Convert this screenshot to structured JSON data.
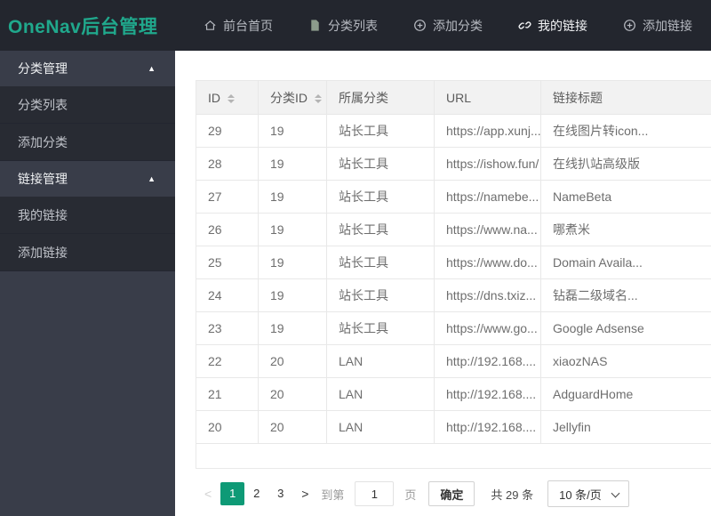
{
  "app": {
    "title": "OneNav后台管理"
  },
  "colors": {
    "accent": "#0e9a76",
    "logo": "#20a88c",
    "topbar_bg": "#23262E",
    "sidebar_bg": "#393D49",
    "sidebar_item_bg": "#282B33",
    "table_header_bg": "#f2f2f2"
  },
  "topnav": {
    "items": [
      {
        "label": "前台首页",
        "icon": "home-icon",
        "active": false
      },
      {
        "label": "分类列表",
        "icon": "document-icon",
        "active": false
      },
      {
        "label": "添加分类",
        "icon": "add-circle-icon",
        "active": false
      },
      {
        "label": "我的链接",
        "icon": "link-icon",
        "active": true
      },
      {
        "label": "添加链接",
        "icon": "add-circle-icon",
        "active": false
      }
    ]
  },
  "sidebar": {
    "arrow": "▲",
    "groups": [
      {
        "label": "分类管理",
        "expanded": true,
        "items": [
          "分类列表",
          "添加分类"
        ]
      },
      {
        "label": "链接管理",
        "expanded": true,
        "items": [
          "我的链接",
          "添加链接"
        ]
      }
    ]
  },
  "table": {
    "columns": [
      {
        "label": "ID",
        "sortable": true
      },
      {
        "label": "分类ID",
        "sortable": true
      },
      {
        "label": "所属分类",
        "sortable": false
      },
      {
        "label": "URL",
        "sortable": false
      },
      {
        "label": "链接标题",
        "sortable": false
      }
    ],
    "rows": [
      [
        "29",
        "19",
        "站长工具",
        "https://app.xunj...",
        "在线图片转icon..."
      ],
      [
        "28",
        "19",
        "站长工具",
        "https://ishow.fun/",
        "在线扒站高级版"
      ],
      [
        "27",
        "19",
        "站长工具",
        "https://namebe...",
        "NameBeta"
      ],
      [
        "26",
        "19",
        "站长工具",
        "https://www.na...",
        "哪煮米"
      ],
      [
        "25",
        "19",
        "站长工具",
        "https://www.do...",
        "Domain Availa..."
      ],
      [
        "24",
        "19",
        "站长工具",
        "https://dns.txiz...",
        "钻磊二级域名..."
      ],
      [
        "23",
        "19",
        "站长工具",
        "https://www.go...",
        "Google Adsense"
      ],
      [
        "22",
        "20",
        "LAN",
        "http://192.168....",
        "xiaozNAS"
      ],
      [
        "21",
        "20",
        "LAN",
        "http://192.168....",
        "AdguardHome"
      ],
      [
        "20",
        "20",
        "LAN",
        "http://192.168....",
        "Jellyfin"
      ]
    ]
  },
  "pagination": {
    "prev": "<",
    "next": ">",
    "pages": [
      "1",
      "2",
      "3"
    ],
    "active_page": "1",
    "goto_label": "到第",
    "goto_value": "1",
    "page_unit": "页",
    "confirm_label": "确定",
    "total_label": "共 29 条",
    "page_size": "10 条/页"
  },
  "icons": {
    "topnav": [
      "home-icon",
      "document-icon",
      "add-circle-icon",
      "link-icon",
      "add-circle-icon"
    ],
    "sidebar_group": "triangle-up-icon",
    "table_sort": "sort-arrows-icon",
    "page_size_select": "chevron-down-icon"
  }
}
